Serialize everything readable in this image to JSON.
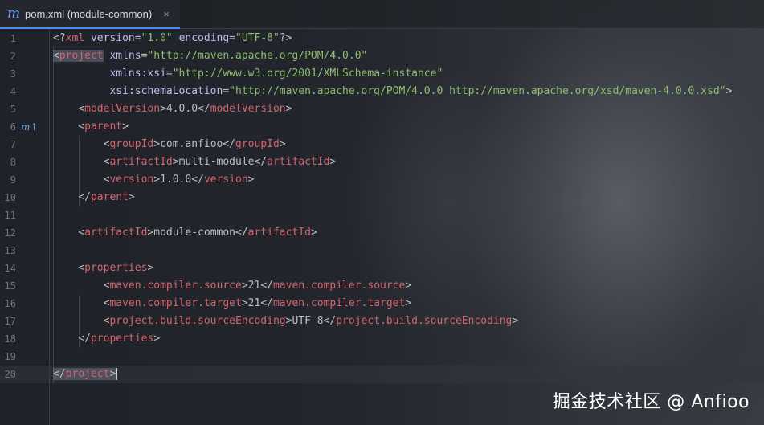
{
  "tab": {
    "icon": "m",
    "label": "pom.xml (module-common)",
    "close": "×"
  },
  "gutter_marker": "m↑",
  "lines": [
    {
      "n": "1",
      "segs": [
        [
          "p",
          "<?"
        ],
        [
          "t",
          "xml"
        ],
        [
          "x",
          " "
        ],
        [
          "a",
          "version"
        ],
        [
          "x",
          "="
        ],
        [
          "s",
          "\"1.0\""
        ],
        [
          "x",
          " "
        ],
        [
          "a",
          "encoding"
        ],
        [
          "x",
          "="
        ],
        [
          "s",
          "\"UTF-8\""
        ],
        [
          "p",
          "?>"
        ]
      ]
    },
    {
      "n": "2",
      "segs": [
        [
          "p",
          "<"
        ],
        [
          "t",
          "project"
        ],
        [
          "x",
          " "
        ],
        [
          "a",
          "xmlns"
        ],
        [
          "x",
          "="
        ],
        [
          "s",
          "\"http://maven.apache.org/POM/4.0.0\""
        ]
      ]
    },
    {
      "n": "3",
      "segs": [
        [
          "x",
          "         "
        ],
        [
          "a",
          "xmlns:xsi"
        ],
        [
          "x",
          "="
        ],
        [
          "s",
          "\"http://www.w3.org/2001/XMLSchema-instance\""
        ]
      ]
    },
    {
      "n": "4",
      "segs": [
        [
          "x",
          "         "
        ],
        [
          "a",
          "xsi:schemaLocation"
        ],
        [
          "x",
          "="
        ],
        [
          "s",
          "\"http://maven.apache.org/POM/4.0.0 http://maven.apache.org/xsd/maven-4.0.0.xsd\""
        ],
        [
          "p",
          ">"
        ]
      ]
    },
    {
      "n": "5",
      "segs": [
        [
          "x",
          "    "
        ],
        [
          "p",
          "<"
        ],
        [
          "t",
          "modelVersion"
        ],
        [
          "p",
          ">"
        ],
        [
          "x",
          "4.0.0"
        ],
        [
          "p",
          "</"
        ],
        [
          "t",
          "modelVersion"
        ],
        [
          "p",
          ">"
        ]
      ]
    },
    {
      "n": "6",
      "segs": [
        [
          "x",
          "    "
        ],
        [
          "p",
          "<"
        ],
        [
          "t",
          "parent"
        ],
        [
          "p",
          ">"
        ]
      ]
    },
    {
      "n": "7",
      "segs": [
        [
          "x",
          "        "
        ],
        [
          "p",
          "<"
        ],
        [
          "t",
          "groupId"
        ],
        [
          "p",
          ">"
        ],
        [
          "x",
          "com.anfioo"
        ],
        [
          "p",
          "</"
        ],
        [
          "t",
          "groupId"
        ],
        [
          "p",
          ">"
        ]
      ]
    },
    {
      "n": "8",
      "segs": [
        [
          "x",
          "        "
        ],
        [
          "p",
          "<"
        ],
        [
          "t",
          "artifactId"
        ],
        [
          "p",
          ">"
        ],
        [
          "x",
          "multi-module"
        ],
        [
          "p",
          "</"
        ],
        [
          "t",
          "artifactId"
        ],
        [
          "p",
          ">"
        ]
      ]
    },
    {
      "n": "9",
      "segs": [
        [
          "x",
          "        "
        ],
        [
          "p",
          "<"
        ],
        [
          "t",
          "version"
        ],
        [
          "p",
          ">"
        ],
        [
          "x",
          "1.0.0"
        ],
        [
          "p",
          "</"
        ],
        [
          "t",
          "version"
        ],
        [
          "p",
          ">"
        ]
      ]
    },
    {
      "n": "10",
      "segs": [
        [
          "x",
          "    "
        ],
        [
          "p",
          "</"
        ],
        [
          "t",
          "parent"
        ],
        [
          "p",
          ">"
        ]
      ]
    },
    {
      "n": "11",
      "segs": []
    },
    {
      "n": "12",
      "segs": [
        [
          "x",
          "    "
        ],
        [
          "p",
          "<"
        ],
        [
          "t",
          "artifactId"
        ],
        [
          "p",
          ">"
        ],
        [
          "x",
          "module-common"
        ],
        [
          "p",
          "</"
        ],
        [
          "t",
          "artifactId"
        ],
        [
          "p",
          ">"
        ]
      ]
    },
    {
      "n": "13",
      "segs": []
    },
    {
      "n": "14",
      "segs": [
        [
          "x",
          "    "
        ],
        [
          "p",
          "<"
        ],
        [
          "t",
          "properties"
        ],
        [
          "p",
          ">"
        ]
      ]
    },
    {
      "n": "15",
      "segs": [
        [
          "x",
          "        "
        ],
        [
          "p",
          "<"
        ],
        [
          "t",
          "maven.compiler.source"
        ],
        [
          "p",
          ">"
        ],
        [
          "x",
          "21"
        ],
        [
          "p",
          "</"
        ],
        [
          "t",
          "maven.compiler.source"
        ],
        [
          "p",
          ">"
        ]
      ]
    },
    {
      "n": "16",
      "segs": [
        [
          "x",
          "        "
        ],
        [
          "p",
          "<"
        ],
        [
          "t",
          "maven.compiler.target"
        ],
        [
          "p",
          ">"
        ],
        [
          "x",
          "21"
        ],
        [
          "p",
          "</"
        ],
        [
          "t",
          "maven.compiler.target"
        ],
        [
          "p",
          ">"
        ]
      ]
    },
    {
      "n": "17",
      "segs": [
        [
          "x",
          "        "
        ],
        [
          "p",
          "<"
        ],
        [
          "t",
          "project.build.sourceEncoding"
        ],
        [
          "p",
          ">"
        ],
        [
          "x",
          "UTF-8"
        ],
        [
          "p",
          "</"
        ],
        [
          "t",
          "project.build.sourceEncoding"
        ],
        [
          "p",
          ">"
        ]
      ]
    },
    {
      "n": "18",
      "segs": [
        [
          "x",
          "    "
        ],
        [
          "p",
          "</"
        ],
        [
          "t",
          "properties"
        ],
        [
          "p",
          ">"
        ]
      ]
    },
    {
      "n": "19",
      "segs": []
    },
    {
      "n": "20",
      "segs": [
        [
          "p",
          "</"
        ],
        [
          "t",
          "project"
        ],
        [
          "p",
          ">"
        ]
      ]
    }
  ],
  "watermark": "掘金技术社区 @ Anfioo",
  "colors": {
    "tag": "#d5646d",
    "attribute": "#c7b8ef",
    "string": "#8dbd6e",
    "text": "#bcbec4",
    "accent": "#4a8cf7"
  }
}
